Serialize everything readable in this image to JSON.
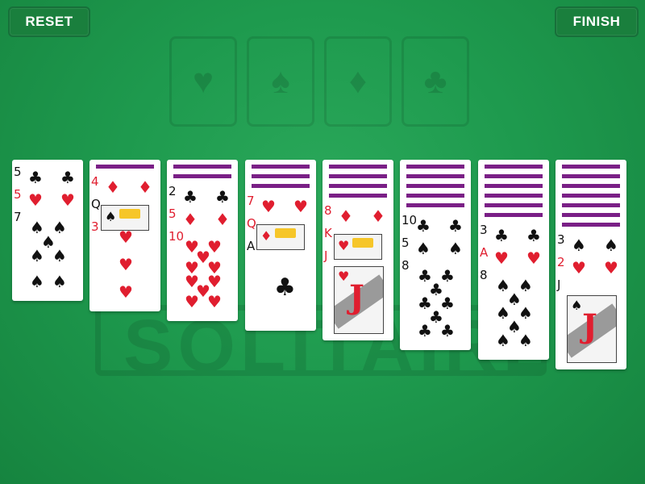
{
  "buttons": {
    "reset": "RESET",
    "finish": "FINISH"
  },
  "watermark": "SOLITAIRE",
  "foundations": [
    {
      "suit": "heart",
      "glyph": "♥"
    },
    {
      "suit": "spade",
      "glyph": "♠"
    },
    {
      "suit": "diamond",
      "glyph": "♦"
    },
    {
      "suit": "club",
      "glyph": "♣"
    }
  ],
  "colors": {
    "table": "#1e9a4e",
    "card_back": "#7a1f86",
    "red": "#e01e2f"
  },
  "tableau": [
    {
      "hidden": 0,
      "cards": [
        {
          "rank": "5",
          "suit": "club"
        },
        {
          "rank": "5",
          "suit": "heart"
        },
        {
          "rank": "7",
          "suit": "spade"
        }
      ]
    },
    {
      "hidden": 1,
      "cards": [
        {
          "rank": "4",
          "suit": "diamond"
        },
        {
          "rank": "Q",
          "suit": "spade"
        },
        {
          "rank": "3",
          "suit": "heart"
        }
      ]
    },
    {
      "hidden": 2,
      "cards": [
        {
          "rank": "2",
          "suit": "club"
        },
        {
          "rank": "5",
          "suit": "diamond"
        },
        {
          "rank": "10",
          "suit": "heart"
        }
      ]
    },
    {
      "hidden": 3,
      "cards": [
        {
          "rank": "7",
          "suit": "heart"
        },
        {
          "rank": "Q",
          "suit": "diamond"
        },
        {
          "rank": "A",
          "suit": "club"
        }
      ]
    },
    {
      "hidden": 4,
      "cards": [
        {
          "rank": "8",
          "suit": "diamond"
        },
        {
          "rank": "K",
          "suit": "heart"
        },
        {
          "rank": "J",
          "suit": "heart"
        }
      ]
    },
    {
      "hidden": 5,
      "cards": [
        {
          "rank": "10",
          "suit": "club"
        },
        {
          "rank": "5",
          "suit": "spade"
        },
        {
          "rank": "8",
          "suit": "club"
        }
      ]
    },
    {
      "hidden": 6,
      "cards": [
        {
          "rank": "3",
          "suit": "club"
        },
        {
          "rank": "A",
          "suit": "heart"
        },
        {
          "rank": "8",
          "suit": "spade"
        }
      ]
    },
    {
      "hidden": 7,
      "cards": [
        {
          "rank": "3",
          "suit": "spade"
        },
        {
          "rank": "2",
          "suit": "heart"
        },
        {
          "rank": "J",
          "suit": "spade"
        }
      ]
    }
  ]
}
